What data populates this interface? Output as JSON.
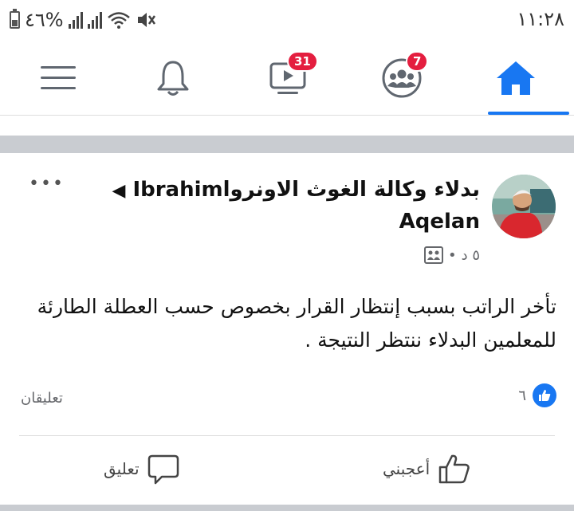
{
  "status_bar": {
    "battery_percent": "%٤٦",
    "time": "١١:٢٨"
  },
  "tabs": [
    {
      "name": "menu",
      "icon": "hamburger-menu-icon"
    },
    {
      "name": "notifications",
      "icon": "bell-icon"
    },
    {
      "name": "watch",
      "icon": "video-icon",
      "badge": "31"
    },
    {
      "name": "groups",
      "icon": "groups-icon",
      "badge": "7"
    },
    {
      "name": "home",
      "icon": "home-icon",
      "active": true
    }
  ],
  "colors": {
    "accent": "#1877f2",
    "badge": "#e41e3f",
    "separator": "#c9ccd1"
  },
  "post": {
    "group_name": "بدلاء وكالة الغوث الاونروا",
    "author_first": "Ibrahim",
    "author_last": "Aqelan",
    "time": "٥ د",
    "privacy_icon": "group-privacy-icon",
    "text": "تأخر الراتب بسبب إنتظار القرار بخصوص حسب العطلة الطارئة للمعلمين البدلاء ننتظر النتيجة .",
    "reactions_count": "٦",
    "comments_label": "تعليقان",
    "like_label": "أعجبني",
    "comment_label": "تعليق"
  }
}
